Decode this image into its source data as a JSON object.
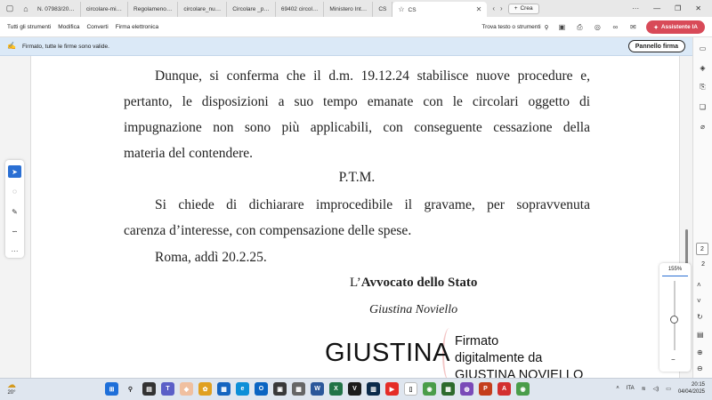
{
  "tabs": [
    {
      "label": "N. 07983/20…"
    },
    {
      "label": "circolare-mi…"
    },
    {
      "label": "Regolameno…"
    },
    {
      "label": "circolare_nu…"
    },
    {
      "label": "Circolare _p…"
    },
    {
      "label": "69402 circol…"
    },
    {
      "label": "Ministero Int…"
    },
    {
      "label": "CS"
    }
  ],
  "active_tab": {
    "label": "CS"
  },
  "crea_label": "Crea",
  "menu": [
    "Tutti gli strumenti",
    "Modifica",
    "Converti",
    "Firma elettronica"
  ],
  "find_label": "Trova testo o strumenti",
  "ai_button_label": "Assistente IA",
  "notification": {
    "text": "Firmato, tutte le firme sono valide.",
    "button": "Pannello firma"
  },
  "document": {
    "para1_lines": [
      "Dunque, si conferma che il d.m. 19.12.24 stabilisce nuove procedure e,",
      "pertanto, le disposizioni a suo tempo emanate con le circolari oggetto di",
      "impugnazione non sono più applicabili, con conseguente cessazione della",
      "materia del contendere."
    ],
    "ptm": "P.T.M.",
    "para2_lines": [
      "Si chiede di dichiarare improcedibile il gravame, per sopravvenuta",
      "carenza d’interesse, con compensazione delle spese."
    ],
    "place_date": "Roma, addì 20.2.25.",
    "sig_prefix": "L’",
    "sig_role": "Avvocato dello Stato",
    "sig_name": "Giustina Noviello",
    "stamp_name": "GIUSTINA",
    "stamp_lines": [
      "Firmato",
      "digitalmente da",
      "GIUSTINA NOVIELLO"
    ]
  },
  "page_number": "2",
  "page_total": "2",
  "zoom_value": "155%",
  "zoom_level_fraction": 0.55,
  "taskbar": {
    "temperature": "20°",
    "language": "ITA",
    "time": "20:15",
    "date": "04/04/2025"
  },
  "colors": {
    "accent": "#2a6fd3",
    "ai_button": "#d84a58",
    "notification_bg": "#dbe9f7"
  }
}
